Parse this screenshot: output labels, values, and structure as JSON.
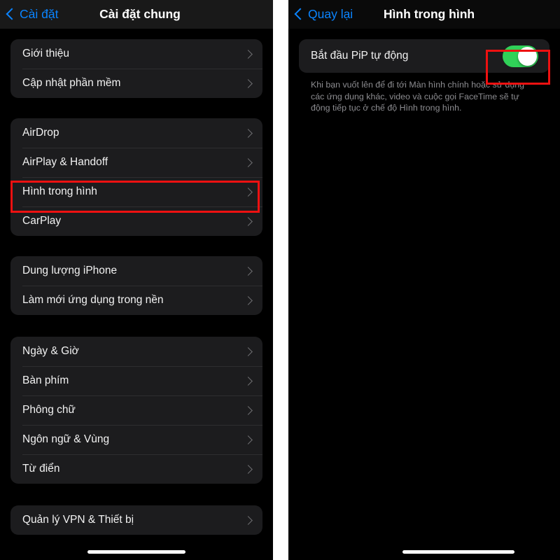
{
  "left_panel": {
    "nav": {
      "back_label": "Cài đặt",
      "title": "Cài đặt chung",
      "back_icon": "chevron-left-icon"
    },
    "groups": [
      {
        "rows": [
          {
            "label": "Giới thiệu"
          },
          {
            "label": "Cập nhật phần mềm"
          }
        ]
      },
      {
        "rows": [
          {
            "label": "AirDrop"
          },
          {
            "label": "AirPlay & Handoff"
          },
          {
            "label": "Hình trong hình"
          },
          {
            "label": "CarPlay"
          }
        ]
      },
      {
        "rows": [
          {
            "label": "Dung lượng iPhone"
          },
          {
            "label": "Làm mới ứng dụng trong nền"
          }
        ]
      },
      {
        "rows": [
          {
            "label": "Ngày & Giờ"
          },
          {
            "label": "Bàn phím"
          },
          {
            "label": "Phông chữ"
          },
          {
            "label": "Ngôn ngữ & Vùng"
          },
          {
            "label": "Từ điển"
          }
        ]
      },
      {
        "rows": [
          {
            "label": "Quản lý VPN & Thiết bị"
          }
        ]
      }
    ]
  },
  "right_panel": {
    "nav": {
      "back_label": "Quay lại",
      "title": "Hình trong hình",
      "back_icon": "chevron-left-icon"
    },
    "toggle_row": {
      "label": "Bắt đầu PiP tự động",
      "state": "on",
      "state_color": "#30d158"
    },
    "footnote": "Khi bạn vuốt lên để đi tới Màn hình chính hoặc sử dụng các ứng dụng khác, video và cuộc gọi FaceTime sẽ tự động tiếp tục ở chế độ Hình trong hình."
  },
  "annotations": {
    "highlight_color": "#ee1111",
    "boxes": [
      {
        "target": "Hình trong hình"
      },
      {
        "target": "Bắt đầu PiP tự động"
      }
    ]
  }
}
